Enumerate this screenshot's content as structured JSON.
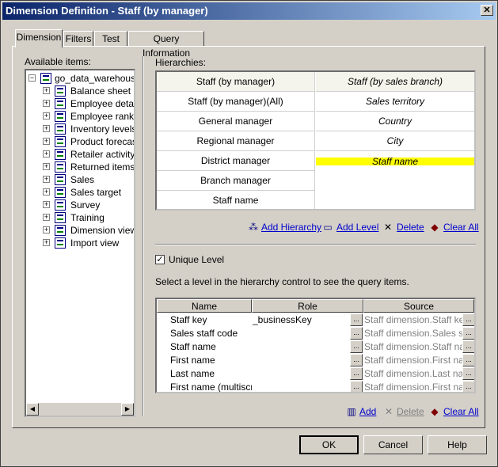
{
  "window": {
    "title": "Dimension Definition - Staff (by manager)",
    "close": "✕"
  },
  "tabs": [
    {
      "label": "Dimension"
    },
    {
      "label": "Filters"
    },
    {
      "label": "Test"
    },
    {
      "label": "Query Information"
    }
  ],
  "left": {
    "label": "Available items:",
    "root": "go_data_warehouse",
    "items": [
      "Balance sheet",
      "Employee detail",
      "Employee rankin",
      "Inventory levels",
      "Product forecast",
      "Retailer activity",
      "Returned items",
      "Sales",
      "Sales target",
      "Survey",
      "Training",
      "Dimension view",
      "Import view"
    ]
  },
  "hierarchies": {
    "label": "Hierarchies:",
    "col1": [
      "Staff (by manager)",
      "Staff (by manager)(All)",
      "General manager",
      "Regional manager",
      "District manager",
      "Branch manager",
      "Staff name"
    ],
    "col2": [
      "Staff (by sales branch)",
      "Sales territory",
      "Country",
      "City",
      "Staff name"
    ],
    "highlight_color": "#ffff00"
  },
  "hier_actions": {
    "add_hierarchy": "Add Hierarchy",
    "add_level": "Add Level",
    "delete": "Delete",
    "clear_all": "Clear All"
  },
  "unique_level": {
    "label": "Unique Level",
    "checked": "✓"
  },
  "instruction": "Select a level in the hierarchy control to see the query items.",
  "query": {
    "headers": {
      "name": "Name",
      "role": "Role",
      "source": "Source"
    },
    "rows": [
      {
        "name": "Staff key",
        "role": "_businessKey",
        "source": "Staff dimension.Staff key"
      },
      {
        "name": "Sales staff code",
        "role": "",
        "source": "Staff dimension.Sales staff code"
      },
      {
        "name": "Staff name",
        "role": "",
        "source": "Staff dimension.Staff name"
      },
      {
        "name": "First name",
        "role": "",
        "source": "Staff dimension.First name"
      },
      {
        "name": "Last name",
        "role": "",
        "source": "Staff dimension.Last name"
      },
      {
        "name": "First name (multiscript)",
        "role": "",
        "source": "Staff dimension.First name (multiscript)"
      }
    ],
    "dots": "..."
  },
  "query_actions": {
    "add": "Add",
    "delete": "Delete",
    "clear_all": "Clear All"
  },
  "buttons": {
    "ok": "OK",
    "cancel": "Cancel",
    "help": "Help"
  }
}
